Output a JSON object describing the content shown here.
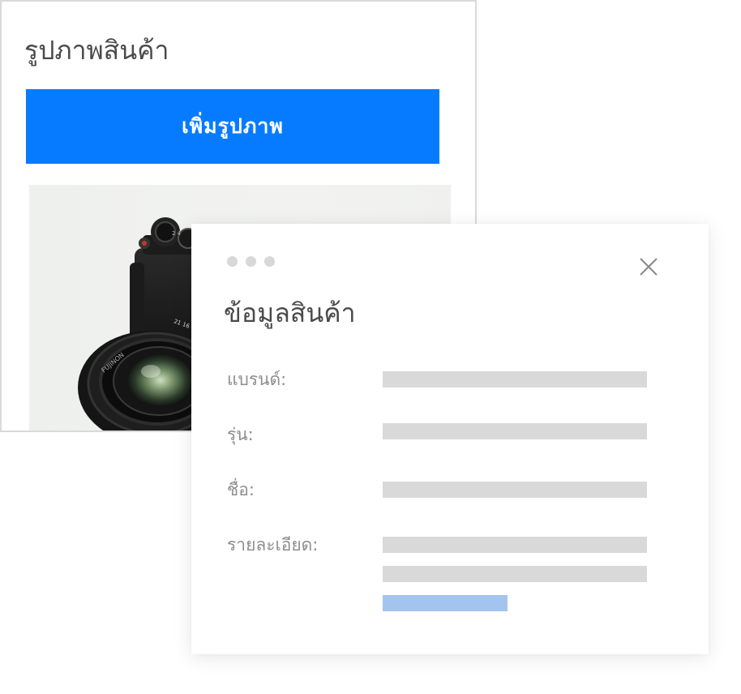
{
  "image_panel": {
    "title": "รูปภาพสินค้า",
    "add_image_label": "เพิ่มรูปภาพ",
    "accent_color": "#077bff"
  },
  "info_card": {
    "title": "ข้อมูลสินค้า",
    "fields": [
      {
        "label": "แบรนด์:"
      },
      {
        "label": "รุ่น:"
      },
      {
        "label": "ชื่อ:"
      },
      {
        "label": "รายละเอียด:"
      }
    ],
    "close_icon": "close-icon",
    "placeholder_color": "#d9d9d9",
    "highlight_color": "#a3c4ee"
  }
}
